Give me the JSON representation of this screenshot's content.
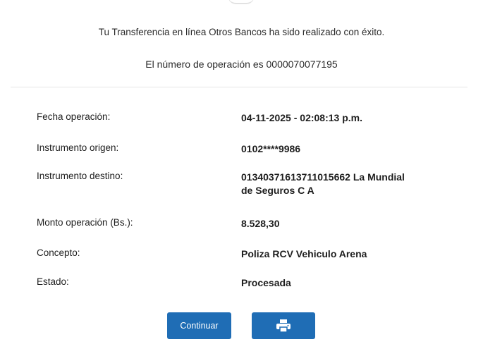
{
  "confirmation": {
    "success_message": "Tu Transferencia en línea Otros Bancos ha sido realizado con éxito.",
    "operation_number_text": "El número de operación es 0000070077195"
  },
  "details": [
    {
      "label": "Fecha operación:",
      "value": "04-11-2025 - 02:08:13 p.m."
    },
    {
      "label": "Instrumento origen:",
      "value": "0102****9986"
    },
    {
      "label": "Instrumento destino:",
      "value": "01340371613711015662 La Mundial de Seguros C A"
    },
    {
      "label": "Monto operación (Bs.):",
      "value": "8.528,30"
    },
    {
      "label": "Concepto:",
      "value": "Poliza RCV Vehiculo Arena"
    },
    {
      "label": "Estado:",
      "value": "Procesada"
    }
  ],
  "actions": {
    "continue_label": "Continuar",
    "print_icon": "printer-icon"
  },
  "colors": {
    "primary_button": "#1f6db5",
    "text": "#1e1e1e",
    "divider": "#e6e6e6"
  }
}
